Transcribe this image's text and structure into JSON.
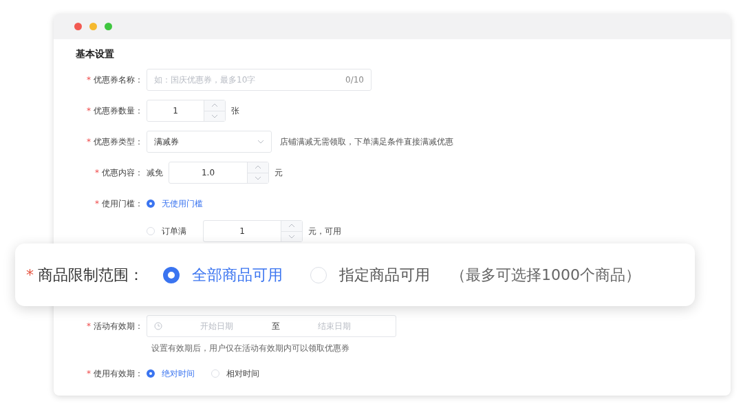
{
  "section_title": "基本设置",
  "fields": [
    {
      "kind": "text",
      "mark": "*",
      "label": "优惠券名称：",
      "placeholder": "如：国庆优惠券，最多10字",
      "counter": "0/10"
    },
    {
      "kind": "number",
      "mark": "*",
      "label": "优惠券数量：",
      "value": "1",
      "unit": "张"
    },
    {
      "kind": "select",
      "mark": "*",
      "label": "优惠券类型：",
      "value": "满减券",
      "note": "店铺满减无需领取，下单满足条件直接满减优惠"
    },
    {
      "kind": "number",
      "mark": "*",
      "label": "优惠内容：",
      "prefix": "减免",
      "value": "1.0",
      "unit": "元"
    },
    {
      "kind": "radio",
      "mark": "*",
      "label": "使用门槛：",
      "stacked": true,
      "options": [
        {
          "label": "无使用门槛",
          "selected": true
        },
        {
          "label": "订单满",
          "selected": false,
          "value": "1",
          "unit": "元，可用"
        }
      ]
    },
    {
      "kind": "daterange",
      "mark": "*",
      "label": "活动有效期：",
      "start_placeholder": "开始日期",
      "separator": "至",
      "end_placeholder": "结束日期",
      "hint": "设置有效期后，用户仅在活动有效期内可以领取优惠券"
    },
    {
      "kind": "radio",
      "mark": "*",
      "label": "使用有效期：",
      "stacked": false,
      "options": [
        {
          "label": "绝对时间",
          "selected": true
        },
        {
          "label": "相对时间",
          "selected": false
        }
      ]
    }
  ],
  "callout": {
    "mark": "*",
    "label": "商品限制范围：",
    "options": [
      {
        "label": "全部商品可用",
        "selected": true
      },
      {
        "label": "指定商品可用",
        "selected": false
      }
    ],
    "note": "（最多可选择1000个商品）"
  }
}
